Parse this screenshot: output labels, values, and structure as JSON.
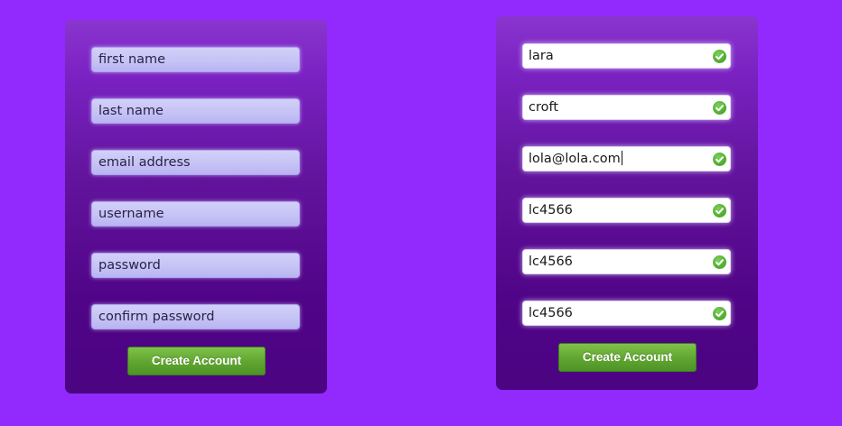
{
  "colors": {
    "background": "#9229fd",
    "panel_top": "#8a35cf",
    "panel_bottom": "#4b0482",
    "button_green": "#62a732",
    "valid_check": "#4aa92b"
  },
  "empty_form": {
    "placeholders": [
      "first name",
      "last name",
      "email address",
      "username",
      "password",
      "confirm password"
    ],
    "button_label": "Create Account"
  },
  "filled_form": {
    "values": [
      "lara",
      "croft",
      "lola@lola.com",
      "lc4566",
      "lc4566",
      "lc4566"
    ],
    "validation_icon": "check-circle-icon",
    "button_label": "Create Account"
  }
}
